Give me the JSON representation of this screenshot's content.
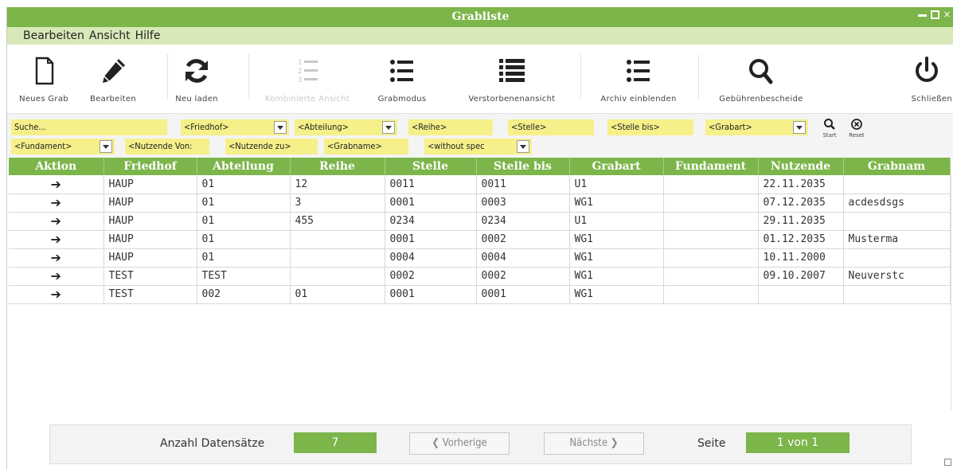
{
  "window": {
    "title": "Grabliste"
  },
  "menu": {
    "items": [
      "Bearbeiten",
      "Ansicht",
      "Hilfe"
    ]
  },
  "toolbar": {
    "new": "Neues Grab",
    "edit": "Bearbeiten",
    "reload": "Neu laden",
    "combined": "Kombinierte Ansicht",
    "grave_mode": "Grabmodus",
    "deceased_view": "Verstorbenenansicht",
    "archive": "Archiv einblenden",
    "fees": "Gebührenbescheide",
    "close": "Schließen"
  },
  "filters": {
    "search": "Suche...",
    "friedhof": "<Friedhof>",
    "abteilung": "<Abteilung>",
    "reihe": "<Reihe>",
    "stelle": "<Stelle>",
    "stelle_bis": "<Stelle bis>",
    "grabart": "<Grabart>",
    "fundament": "<Fundament>",
    "nutzende_von": "<Nutzende Von:",
    "nutzende_zu": "<Nutzende zu>",
    "grabname": "<Grabname>",
    "without_spec": "<without spec",
    "start": "Start",
    "reset": "Reset"
  },
  "table": {
    "columns": [
      "Aktion",
      "Friedhof",
      "Abteilung",
      "Reihe",
      "Stelle",
      "Stelle bis",
      "Grabart",
      "Fundament",
      "Nutzende",
      "Grabnam"
    ],
    "action_glyph": "➔",
    "rows": [
      [
        "HAUP",
        "01",
        "12",
        "0011",
        "0011",
        "U1",
        "",
        "22.11.2035",
        ""
      ],
      [
        "HAUP",
        "01",
        "3",
        "0001",
        "0003",
        "WG1",
        "",
        "07.12.2035",
        "acdesdsgs"
      ],
      [
        "HAUP",
        "01",
        "455",
        "0234",
        "0234",
        "U1",
        "",
        "29.11.2035",
        ""
      ],
      [
        "HAUP",
        "01",
        "",
        "0001",
        "0002",
        "WG1",
        "",
        "01.12.2035",
        "Musterma"
      ],
      [
        "HAUP",
        "01",
        "",
        "0004",
        "0004",
        "WG1",
        "",
        "10.11.2000",
        ""
      ],
      [
        "TEST",
        "TEST",
        "",
        "0002",
        "0002",
        "WG1",
        "",
        "09.10.2007",
        "Neuverstc"
      ],
      [
        "TEST",
        "002",
        "01",
        "0001",
        "0001",
        "WG1",
        "",
        "",
        ""
      ]
    ]
  },
  "footer": {
    "count_label": "Anzahl Datensätze",
    "count_value": "7",
    "prev": "❮ Vorherige",
    "next": "Nächste ❯",
    "page_label": "Seite",
    "page_value": "1 von 1"
  },
  "colors": {
    "accent": "#7cb54a",
    "menu_bg": "#d8e8b8",
    "filter_field": "#f6f08a"
  }
}
